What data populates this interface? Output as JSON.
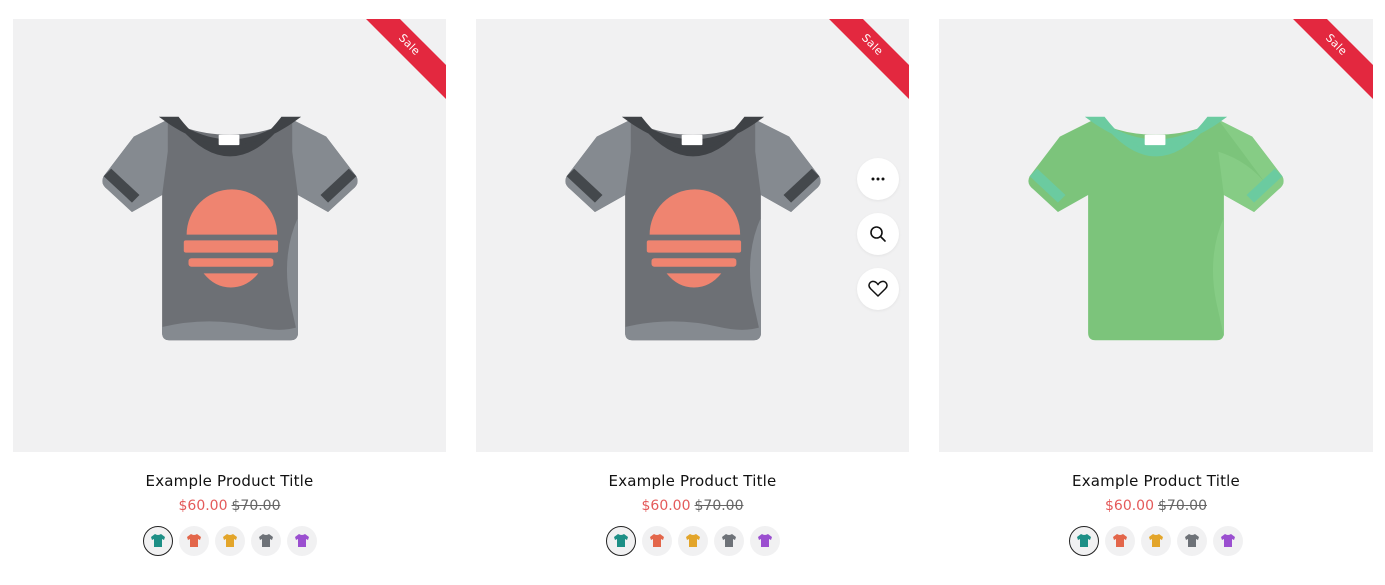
{
  "products": [
    {
      "badge": "Sale",
      "title": "Example Product Title",
      "price": "$60.00",
      "compare_price": "$70.00",
      "shirt_variant": "gray-sun",
      "show_actions": false,
      "swatches": [
        {
          "icon": "teal-shirt-icon",
          "color": "#1d8f86",
          "selected": true
        },
        {
          "icon": "orange-shirt-icon",
          "color": "#e3664a",
          "selected": false
        },
        {
          "icon": "yellow-shirt-icon",
          "color": "#e3a52a",
          "selected": false
        },
        {
          "icon": "gray-shirt-icon",
          "color": "#6e7278",
          "selected": false
        },
        {
          "icon": "purple-shirt-icon",
          "color": "#9b4fd0",
          "selected": false
        }
      ]
    },
    {
      "badge": "Sale",
      "title": "Example Product Title",
      "price": "$60.00",
      "compare_price": "$70.00",
      "shirt_variant": "gray-sun",
      "show_actions": true,
      "swatches": [
        {
          "icon": "teal-shirt-icon",
          "color": "#1d8f86",
          "selected": true
        },
        {
          "icon": "orange-shirt-icon",
          "color": "#e3664a",
          "selected": false
        },
        {
          "icon": "yellow-shirt-icon",
          "color": "#e3a52a",
          "selected": false
        },
        {
          "icon": "gray-shirt-icon",
          "color": "#6e7278",
          "selected": false
        },
        {
          "icon": "purple-shirt-icon",
          "color": "#9b4fd0",
          "selected": false
        }
      ]
    },
    {
      "badge": "Sale",
      "title": "Example Product Title",
      "price": "$60.00",
      "compare_price": "$70.00",
      "shirt_variant": "green",
      "show_actions": false,
      "swatches": [
        {
          "icon": "teal-shirt-icon",
          "color": "#1d8f86",
          "selected": true
        },
        {
          "icon": "orange-shirt-icon",
          "color": "#e3664a",
          "selected": false
        },
        {
          "icon": "yellow-shirt-icon",
          "color": "#e3a52a",
          "selected": false
        },
        {
          "icon": "gray-shirt-icon",
          "color": "#6e7278",
          "selected": false
        },
        {
          "icon": "purple-shirt-icon",
          "color": "#9b4fd0",
          "selected": false
        }
      ]
    }
  ],
  "quick_actions": [
    "more-options-icon",
    "search-icon",
    "heart-icon"
  ],
  "colors": {
    "sale_badge": "#e3283f",
    "price": "#e45a5a",
    "image_bg": "#f1f1f2"
  }
}
